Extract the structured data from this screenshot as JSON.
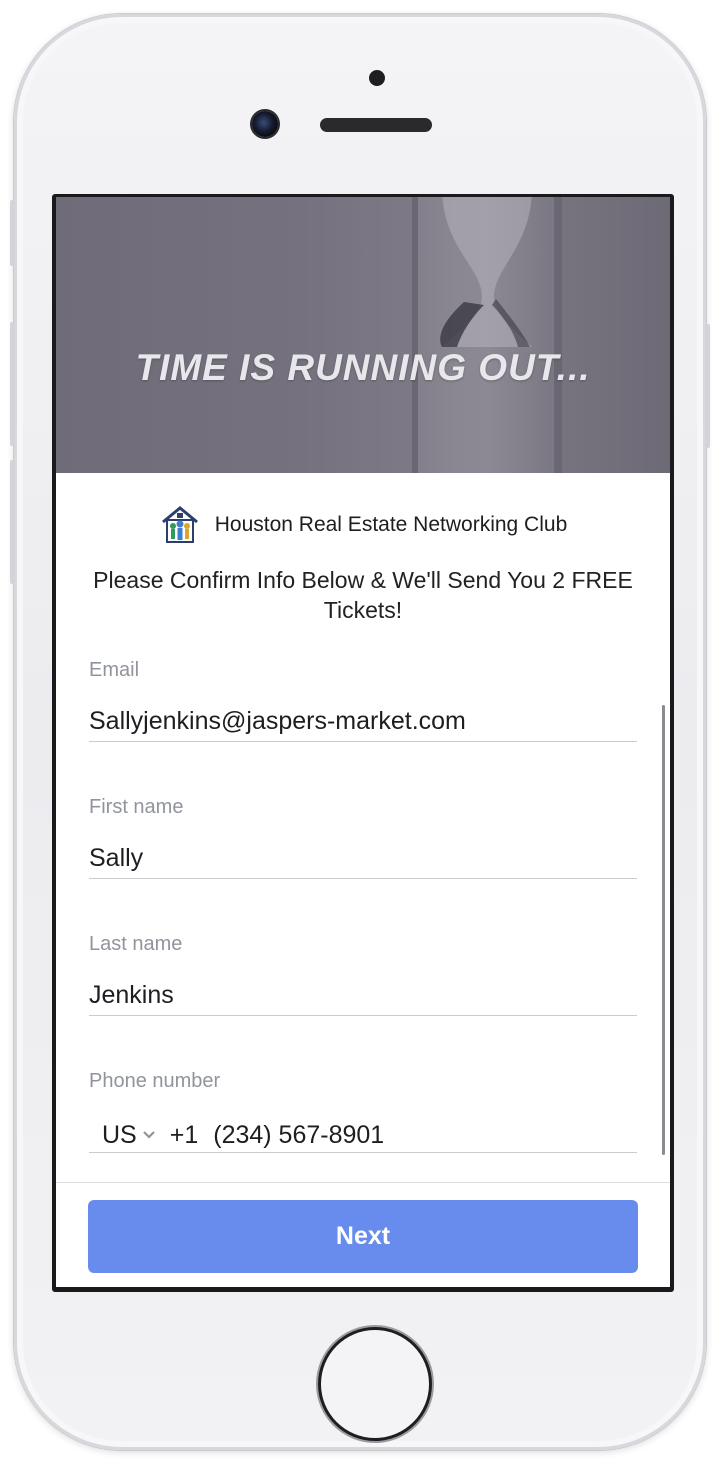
{
  "hero": {
    "headline": "TIME IS RUNNING OUT..."
  },
  "brand": {
    "name": "Houston Real Estate Networking Club",
    "logo_icon": "house-family-logo-icon"
  },
  "form": {
    "intro": "Please Confirm Info Below & We'll Send You 2 FREE Tickets!",
    "email": {
      "label": "Email",
      "value": "Sallyjenkins@jaspers-market.com"
    },
    "first_name": {
      "label": "First name",
      "value": "Sally"
    },
    "last_name": {
      "label": "Last name",
      "value": "Jenkins"
    },
    "phone": {
      "label": "Phone number",
      "country": "US",
      "dial_code": "+1",
      "value": "(234) 567-8901"
    },
    "next_label": "Next"
  },
  "colors": {
    "button": "#678cee",
    "label": "#90949c",
    "text": "#1c1e21"
  }
}
